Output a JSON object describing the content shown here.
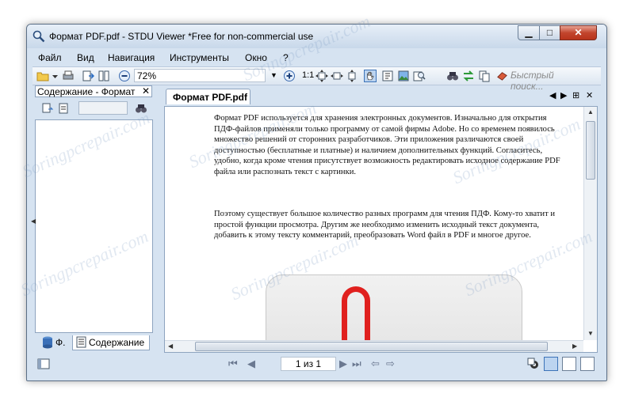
{
  "window": {
    "title": "Формат PDF.pdf - STDU Viewer *Free for non-commercial use",
    "min_glyph": "▁",
    "max_glyph": "□",
    "close_glyph": "✕"
  },
  "menu": [
    {
      "label": "Файл"
    },
    {
      "label": "Вид"
    },
    {
      "label": "Навигация"
    },
    {
      "label": "Инструменты"
    },
    {
      "label": "Окно"
    },
    {
      "label": "?"
    }
  ],
  "toolbar": {
    "zoom_value": "72%",
    "zoom_arrow": "▼",
    "actual_size_label": "1:1",
    "search_placeholder": "Быстрый поиск..."
  },
  "left_panel": {
    "header_title": "Содержание - Формат",
    "close_glyph": "✕",
    "tab_short": "Ф.",
    "tab_contents": "Содержание",
    "collapse_glyph": "◀"
  },
  "document": {
    "tab_title": "Формат PDF.pdf",
    "tab_nav_left": "◀",
    "tab_nav_right": "▶",
    "tab_grid": "⊞",
    "tab_close": "✕",
    "paragraph1": "Формат PDF используется для хранения электронных документов. Изначально для открытия ПДФ-файлов применяли только программу от самой фирмы Adobe. Но со временем появилось множество решений от сторонних разработчиков. Эти приложения различаются своей доступностью (бесплатные и платные) и наличием дополнительных функций. Согласитесь, удобно, когда кроме чтения присутствует возможность редактировать исходное содержание PDF файла или распознать текст с картинки.",
    "paragraph2": "Поэтому существует большое количество разных программ для чтения ПДФ. Кому-то хватит и простой функции просмотра. Другим же необходимо изменить исходный текст документа, добавить к этому тексту комментарий, преобразовать Word файл в PDF и многое другое."
  },
  "status": {
    "page_indicator": "1 из 1",
    "first": "⏮",
    "prev": "◀",
    "next": "▶",
    "last": "⏭",
    "back": "⇦",
    "forward": "⇨"
  },
  "watermark": "Soringpcrepair.com",
  "colors": {
    "window_frame": "#d6e3f1",
    "close_red": "#c2452d",
    "accent_red": "#e0201e"
  }
}
